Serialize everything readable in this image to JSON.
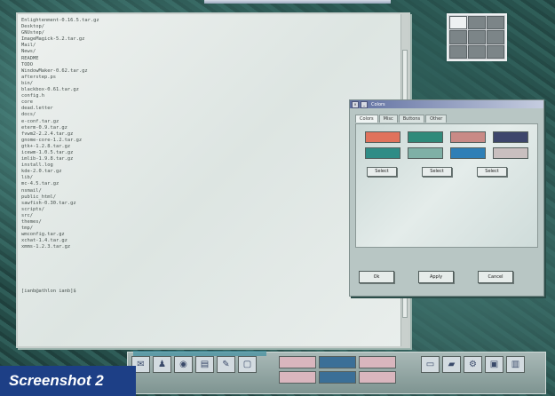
{
  "terminal": {
    "lines": [
      "Enlightenment-0.16.5.tar.gz",
      "Desktop/",
      "GNUstep/",
      "ImageMagick-5.2.tar.gz",
      "Mail/",
      "News/",
      "README",
      "TODO",
      "WindowMaker-0.62.tar.gz",
      "afterstep.ps",
      "bin/",
      "blackbox-0.61.tar.gz",
      "config.h",
      "core",
      "dead.letter",
      "docs/",
      "e-conf.tar.gz",
      "eterm-0.9.tar.gz",
      "fvwm2-2.2.4.tar.gz",
      "gnome-core-1.2.tar.gz",
      "gtk+-1.2.8.tar.gz",
      "icewm-1.0.5.tar.gz",
      "imlib-1.9.8.tar.gz",
      "install.log",
      "kde-2.0.tar.gz",
      "lib/",
      "mc-4.5.tar.gz",
      "nsmail/",
      "public_html/",
      "sawfish-0.30.tar.gz",
      "scripts/",
      "src/",
      "themes/",
      "tmp/",
      "wmconfig.tar.gz",
      "xchat-1.4.tar.gz",
      "xmms-1.2.3.tar.gz",
      "",
      "",
      "",
      "",
      "",
      "",
      "[ianb@athlon ianb]$ "
    ]
  },
  "dialog": {
    "title": "Colors",
    "tabs": [
      "Colors",
      "Misc",
      "Buttons",
      "Other"
    ],
    "panel_buttons": [
      "Select",
      "Select",
      "Select"
    ],
    "dialog_buttons": [
      "Ok",
      "Apply",
      "Cancel"
    ]
  },
  "swatch_colors": [
    "#e0725c",
    "#2f8a7a",
    "#c98a86",
    "#3d466c",
    "#2f8c86",
    "#7fb0a6",
    "#2f7fb6",
    "#c9bfbf"
  ],
  "taskbar": {
    "left_icons": [
      "mail-icon",
      "app-icon",
      "web-icon",
      "term-icon",
      "edit-icon",
      "file-icon"
    ],
    "task_colors": [
      "#d9b6be",
      "#3b6f97",
      "#d9b6be",
      "#d9b6be",
      "#3b6f97",
      "#d9b6be"
    ],
    "right_icons": [
      "monitor-icon",
      "folder-icon",
      "gear-icon",
      "disk-icon",
      "doc-icon"
    ]
  },
  "caption": "Screenshot 2"
}
